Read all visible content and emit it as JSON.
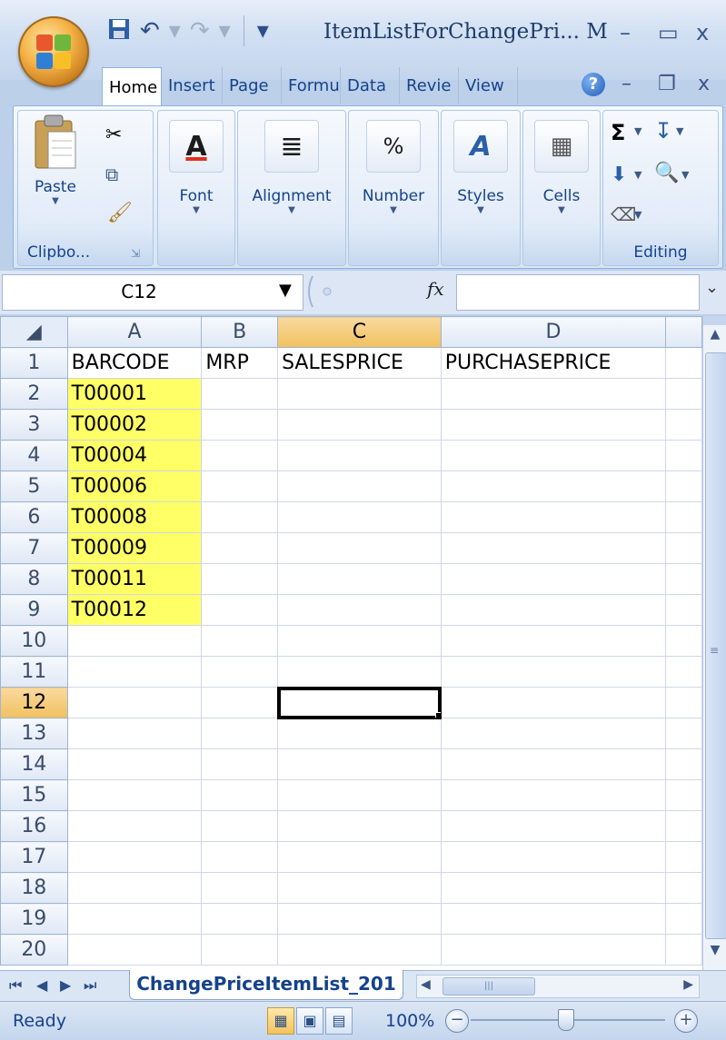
{
  "window": {
    "title": "ItemListForChangePri... M",
    "controls": {
      "minimize": "–",
      "maximize": "▭",
      "close": "x"
    },
    "mdi_controls": {
      "minimize": "–",
      "restore": "❐",
      "close": "x"
    }
  },
  "qat": {
    "save_icon": "💾",
    "undo_icon": "↶",
    "redo_icon": "↷",
    "customize": "▾"
  },
  "ribbon": {
    "tabs": [
      "Home",
      "Insert",
      "Page",
      "Formu",
      "Data",
      "Revie",
      "View"
    ],
    "active_tab": "Home",
    "help": "?",
    "groups": {
      "clipboard": {
        "label": "Clipbo...",
        "paste": "Paste"
      },
      "font": {
        "label": "Font",
        "icon": "A"
      },
      "alignment": {
        "label": "Alignment",
        "icon": "≣"
      },
      "number": {
        "label": "Number",
        "icon": "%"
      },
      "styles": {
        "label": "Styles",
        "icon": "A"
      },
      "cells": {
        "label": "Cells",
        "icon": "▦"
      },
      "editing": {
        "label": "Editing",
        "sum": "Σ",
        "sort": "↧",
        "find": "🔍",
        "fill": "⬇",
        "clear": "⌫"
      }
    }
  },
  "formula_bar": {
    "name_box": "C12",
    "fx": "fx",
    "formula": ""
  },
  "sheet": {
    "columns": [
      "A",
      "B",
      "C",
      "D"
    ],
    "selected_column": "C",
    "selected_row": "12",
    "active_cell": "C12",
    "rows": [
      {
        "n": "1",
        "cells": [
          "BARCODE",
          "MRP",
          "SALESPRICE",
          "PURCHASEPRICE"
        ]
      },
      {
        "n": "2",
        "cells": [
          "T00001",
          "",
          "",
          ""
        ]
      },
      {
        "n": "3",
        "cells": [
          "T00002",
          "",
          "",
          ""
        ]
      },
      {
        "n": "4",
        "cells": [
          "T00004",
          "",
          "",
          ""
        ]
      },
      {
        "n": "5",
        "cells": [
          "T00006",
          "",
          "",
          ""
        ]
      },
      {
        "n": "6",
        "cells": [
          "T00008",
          "",
          "",
          ""
        ]
      },
      {
        "n": "7",
        "cells": [
          "T00009",
          "",
          "",
          ""
        ]
      },
      {
        "n": "8",
        "cells": [
          "T00011",
          "",
          "",
          ""
        ]
      },
      {
        "n": "9",
        "cells": [
          "T00012",
          "",
          "",
          ""
        ]
      },
      {
        "n": "10",
        "cells": [
          "",
          "",
          "",
          ""
        ]
      },
      {
        "n": "11",
        "cells": [
          "",
          "",
          "",
          ""
        ]
      },
      {
        "n": "12",
        "cells": [
          "",
          "",
          "",
          ""
        ]
      },
      {
        "n": "13",
        "cells": [
          "",
          "",
          "",
          ""
        ]
      },
      {
        "n": "14",
        "cells": [
          "",
          "",
          "",
          ""
        ]
      },
      {
        "n": "15",
        "cells": [
          "",
          "",
          "",
          ""
        ]
      },
      {
        "n": "16",
        "cells": [
          "",
          "",
          "",
          ""
        ]
      },
      {
        "n": "17",
        "cells": [
          "",
          "",
          "",
          ""
        ]
      },
      {
        "n": "18",
        "cells": [
          "",
          "",
          "",
          ""
        ]
      },
      {
        "n": "19",
        "cells": [
          "",
          "",
          "",
          ""
        ]
      },
      {
        "n": "20",
        "cells": [
          "",
          "",
          "",
          ""
        ]
      }
    ],
    "highlight_color": "#ffff66",
    "highlight_rows": [
      "2",
      "3",
      "4",
      "5",
      "6",
      "7",
      "8",
      "9"
    ]
  },
  "sheet_tabs": {
    "active": "ChangePriceItemList_201",
    "nav": [
      "⏮",
      "◀",
      "▶",
      "⏭"
    ]
  },
  "status": {
    "text": "Ready",
    "zoom": "100%",
    "zoom_out": "−",
    "zoom_in": "+",
    "zoom_level": 1.0
  }
}
